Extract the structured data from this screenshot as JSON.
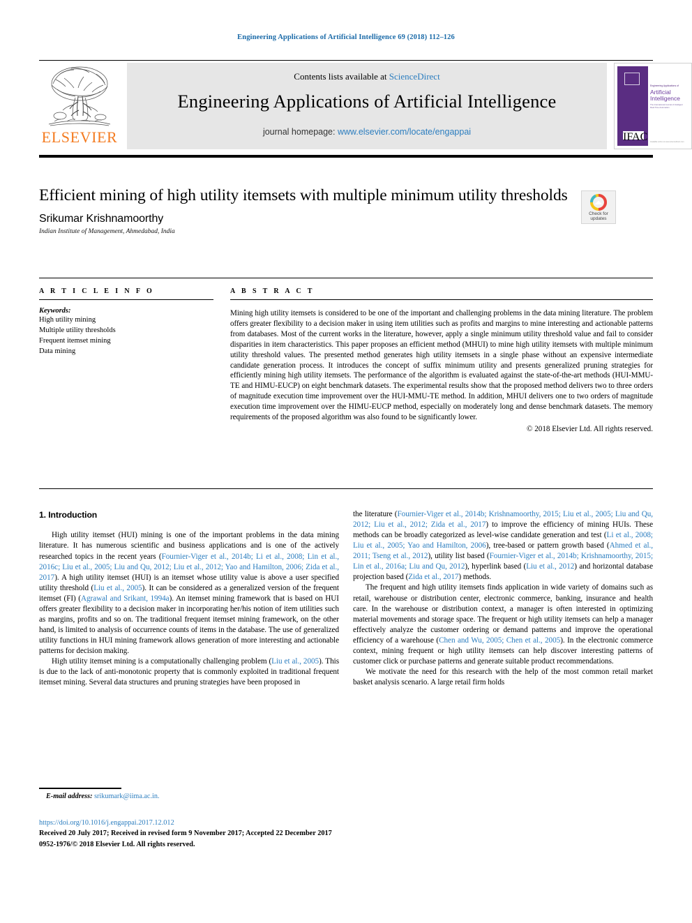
{
  "running_head": "Engineering Applications of Artificial Intelligence 69 (2018) 112–126",
  "masthead": {
    "publisher_name": "ELSEVIER",
    "contents_prefix": "Contents lists available at ",
    "contents_link": "ScienceDirect",
    "journal_title": "Engineering Applications of Artificial Intelligence",
    "homepage_prefix": "journal homepage: ",
    "homepage_url": "www.elsevier.com/locate/engappai",
    "cover": {
      "line1": "Engineering Applications of",
      "line2": "Artificial",
      "line3": "Intelligence",
      "line4": "The International Journal of Intelligent Real-Time Automation",
      "footer": "Available online at www.sciencedirect.com",
      "badge": "IFAC"
    }
  },
  "article": {
    "title": "Efficient mining of high utility itemsets with multiple minimum utility thresholds",
    "author": "Srikumar Krishnamoorthy",
    "affiliation": "Indian Institute of Management, Ahmedabad, India",
    "crossmark_label_line1": "Check for",
    "crossmark_label_line2": "updates"
  },
  "info": {
    "heading": "A R T I C L E   I N F O",
    "keywords_heading": "Keywords:",
    "keywords": [
      "High utility mining",
      "Multiple utility thresholds",
      "Frequent itemset mining",
      "Data mining"
    ]
  },
  "abstract": {
    "heading": "A B S T R A C T",
    "text": "Mining high utility itemsets is considered to be one of the important and challenging problems in the data mining literature. The problem offers greater flexibility to a decision maker in using item utilities such as profits and margins to mine interesting and actionable patterns from databases. Most of the current works in the literature, however, apply a single minimum utility threshold value and fail to consider disparities in item characteristics. This paper proposes an efficient method (MHUI) to mine high utility itemsets with multiple minimum utility threshold values. The presented method generates high utility itemsets in a single phase without an expensive intermediate candidate generation process. It introduces the concept of suffix minimum utility and presents generalized pruning strategies for efficiently mining high utility itemsets. The performance of the algorithm is evaluated against the state-of-the-art methods (HUI-MMU-TE and HIMU-EUCP) on eight benchmark datasets. The experimental results show that the proposed method delivers two to three orders of magnitude execution time improvement over the HUI-MMU-TE method. In addition, MHUI delivers one to two orders of magnitude execution time improvement over the HIMU-EUCP method, especially on moderately long and dense benchmark datasets. The memory requirements of the proposed algorithm was also found to be significantly lower.",
    "copyright": "© 2018 Elsevier Ltd. All rights reserved."
  },
  "body": {
    "section_heading": "1. Introduction",
    "left_paragraphs": [
      "High utility itemset (HUI) mining is one of the important problems in the data mining literature. It has numerous scientific and business applications and is one of the actively researched topics in the recent years (Fournier-Viger et al., 2014b; Li et al., 2008; Lin et al., 2016c; Liu et al., 2005; Liu and Qu, 2012; Liu et al., 2012; Yao and Hamilton, 2006; Zida et al., 2017). A high utility itemset (HUI) is an itemset whose utility value is above a user specified utility threshold (Liu et al., 2005). It can be considered as a generalized version of the frequent itemset (FI) (Agrawal and Srikant, 1994a). An itemset mining framework that is based on HUI offers greater flexibility to a decision maker in incorporating her/his notion of item utilities such as margins, profits and so on. The traditional frequent itemset mining framework, on the other hand, is limited to analysis of occurrence counts of items in the database. The use of generalized utility functions in HUI mining framework allows generation of more interesting and actionable patterns for decision making.",
      "High utility itemset mining is a computationally challenging problem (Liu et al., 2005). This is due to the lack of anti-monotonic property that is commonly exploited in traditional frequent itemset mining. Several data structures and pruning strategies have been proposed in"
    ],
    "right_paragraphs": [
      "the literature (Fournier-Viger et al., 2014b; Krishnamoorthy, 2015; Liu et al., 2005; Liu and Qu, 2012; Liu et al., 2012; Zida et al., 2017) to improve the efficiency of mining HUIs. These methods can be broadly categorized as level-wise candidate generation and test (Li et al., 2008; Liu et al., 2005; Yao and Hamilton, 2006), tree-based or pattern growth based (Ahmed et al., 2011; Tseng et al., 2012), utility list based (Fournier-Viger et al., 2014b; Krishnamoorthy, 2015; Lin et al., 2016a; Liu and Qu, 2012), hyperlink based (Liu et al., 2012) and horizontal database projection based (Zida et al., 2017) methods.",
      "The frequent and high utility itemsets finds application in wide variety of domains such as retail, warehouse or distribution center, electronic commerce, banking, insurance and health care. In the warehouse or distribution context, a manager is often interested in optimizing material movements and storage space. The frequent or high utility itemsets can help a manager effectively analyze the customer ordering or demand patterns and improve the operational efficiency of a warehouse (Chen and Wu, 2005; Chen et al., 2005). In the electronic commerce context, mining frequent or high utility itemsets can help discover interesting patterns of customer click or purchase patterns and generate suitable product recommendations.",
      "We motivate the need for this research with the help of the most common retail market basket analysis scenario. A large retail firm holds"
    ]
  },
  "footer": {
    "email_label": "E-mail address:",
    "email_address": "srikumark@iima.ac.in.",
    "doi": "https://doi.org/10.1016/j.engappai.2017.12.012",
    "received": "Received 20 July 2017; Received in revised form 9 November 2017; Accepted 22 December 2017",
    "issn_line": "0952-1976/© 2018 Elsevier Ltd. All rights reserved."
  },
  "colors": {
    "link": "#2B7DBF",
    "elsevier_orange": "#F47B20",
    "cover_purple": "#5a2d82"
  }
}
